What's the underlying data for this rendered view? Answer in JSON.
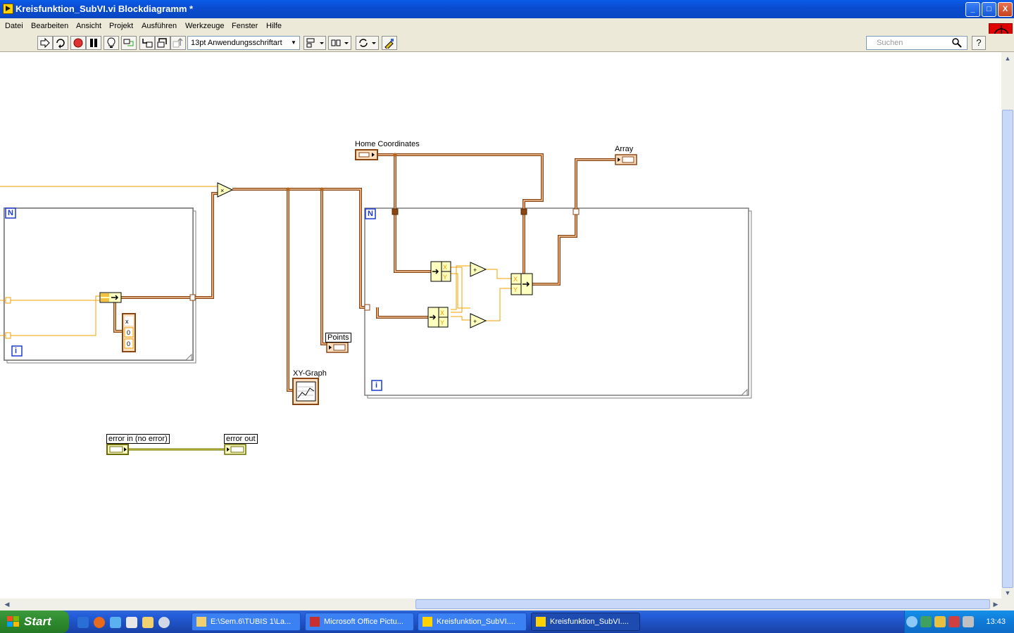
{
  "window": {
    "title": "Kreisfunktion_SubVI.vi Blockdiagramm *",
    "controls": {
      "minimize": "_",
      "maximize": "□",
      "close": "X"
    }
  },
  "menu": [
    "Datei",
    "Bearbeiten",
    "Ansicht",
    "Projekt",
    "Ausführen",
    "Werkzeuge",
    "Fenster",
    "Hilfe"
  ],
  "toolbar": {
    "font": "13pt Anwendungsschriftart",
    "search_placeholder": "Suchen",
    "help": "?"
  },
  "diagram": {
    "labels": {
      "home_coordinates": "Home Coordinates",
      "array": "Array",
      "points": "Points",
      "xy_graph": "XY-Graph",
      "error_in": "error in (no error)",
      "error_out": "error out"
    },
    "loop_count": "N",
    "loop_index": "i",
    "cluster_fields": [
      "x",
      "0",
      "0"
    ],
    "bundle_fields": [
      "X",
      "Y"
    ],
    "ops": {
      "multiply": "×",
      "add": "+"
    }
  },
  "taskbar": {
    "start": "Start",
    "tasks": [
      "E:\\Sem.6\\TUBIS 1\\La...",
      "Microsoft Office Pictu...",
      "Kreisfunktion_SubVI....",
      "Kreisfunktion_SubVI...."
    ],
    "clock": "13:43"
  },
  "colors": {
    "wire_cluster": "#b5651d",
    "wire_numeric": "#f0a000",
    "wire_error": "#6b6b00",
    "loop_border": "#7f7f7f",
    "titlebar": "#0a4cd0"
  }
}
